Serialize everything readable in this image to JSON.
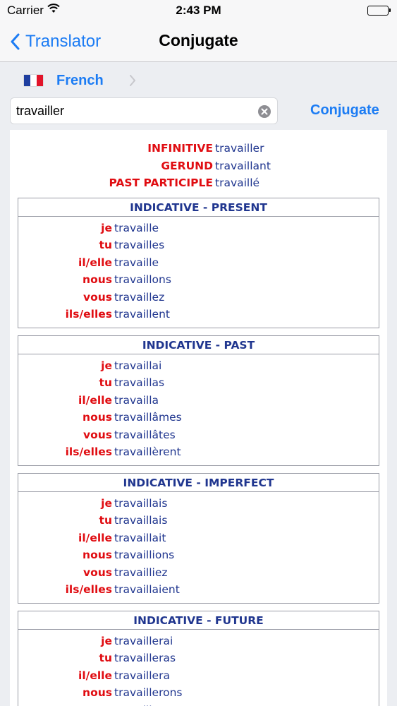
{
  "status": {
    "carrier": "Carrier",
    "time": "2:43 PM"
  },
  "nav": {
    "back_label": "Translator",
    "title": "Conjugate"
  },
  "language": {
    "label": "French",
    "flag_colors": [
      "#1f3fa0",
      "#ffffff",
      "#e2142a"
    ]
  },
  "search": {
    "value": "travailler",
    "button_label": "Conjugate"
  },
  "forms": [
    {
      "label": "INFINITIVE",
      "value": "travailler"
    },
    {
      "label": "GERUND",
      "value": "travaillant"
    },
    {
      "label": "PAST PARTICIPLE",
      "value": "travaillé"
    }
  ],
  "tenses": [
    {
      "title": "INDICATIVE - PRESENT",
      "rows": [
        {
          "pronoun": "je",
          "verb": "travaille"
        },
        {
          "pronoun": "tu",
          "verb": "travailles"
        },
        {
          "pronoun": "il/elle",
          "verb": "travaille"
        },
        {
          "pronoun": "nous",
          "verb": "travaillons"
        },
        {
          "pronoun": "vous",
          "verb": "travaillez"
        },
        {
          "pronoun": "ils/elles",
          "verb": "travaillent"
        }
      ]
    },
    {
      "title": "INDICATIVE - PAST",
      "rows": [
        {
          "pronoun": "je",
          "verb": "travaillai"
        },
        {
          "pronoun": "tu",
          "verb": "travaillas"
        },
        {
          "pronoun": "il/elle",
          "verb": "travailla"
        },
        {
          "pronoun": "nous",
          "verb": "travaillâmes"
        },
        {
          "pronoun": "vous",
          "verb": "travaillâtes"
        },
        {
          "pronoun": "ils/elles",
          "verb": "travaillèrent"
        }
      ]
    },
    {
      "title": "INDICATIVE - IMPERFECT",
      "rows": [
        {
          "pronoun": "je",
          "verb": "travaillais"
        },
        {
          "pronoun": "tu",
          "verb": "travaillais"
        },
        {
          "pronoun": "il/elle",
          "verb": "travaillait"
        },
        {
          "pronoun": "nous",
          "verb": "travaillions"
        },
        {
          "pronoun": "vous",
          "verb": "travailliez"
        },
        {
          "pronoun": "ils/elles",
          "verb": "travaillaient"
        }
      ]
    },
    {
      "title": "INDICATIVE - FUTURE",
      "rows": [
        {
          "pronoun": "je",
          "verb": "travaillerai"
        },
        {
          "pronoun": "tu",
          "verb": "travailleras"
        },
        {
          "pronoun": "il/elle",
          "verb": "travaillera"
        },
        {
          "pronoun": "nous",
          "verb": "travaillerons"
        },
        {
          "pronoun": "vous",
          "verb": "travaillerez"
        }
      ]
    }
  ],
  "colors": {
    "accent": "#1c7cf4",
    "label_red": "#e00d12",
    "verb_blue": "#20368f"
  }
}
